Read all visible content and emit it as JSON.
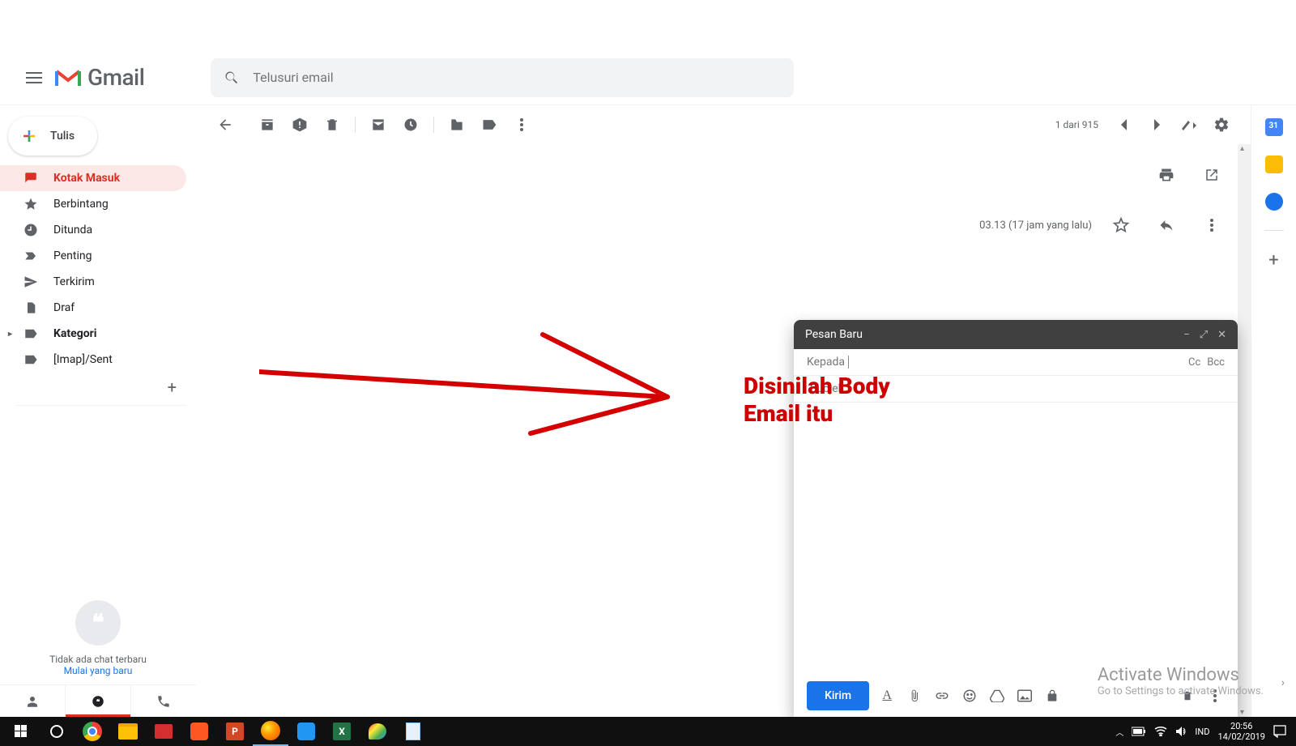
{
  "header": {
    "app_name": "Gmail",
    "search_placeholder": "Telusuri email"
  },
  "compose_button": "Tulis",
  "sidebar": {
    "items": [
      {
        "label": "Kotak Masuk"
      },
      {
        "label": "Berbintang"
      },
      {
        "label": "Ditunda"
      },
      {
        "label": "Penting"
      },
      {
        "label": "Terkirim"
      },
      {
        "label": "Draf"
      },
      {
        "label": "Kategori"
      },
      {
        "label": "[Imap]/Sent"
      }
    ]
  },
  "hangouts": {
    "no_chat": "Tidak ada chat terbaru",
    "start_new": "Mulai yang baru"
  },
  "toolbar": {
    "pager": "1 dari 915"
  },
  "message": {
    "time": "03.13 (17 jam yang lalu)"
  },
  "compose": {
    "title": "Pesan Baru",
    "to_label": "Kepada",
    "cc": "Cc",
    "bcc": "Bcc",
    "subject_placeholder": "Subjek",
    "send": "Kirim"
  },
  "annotation": {
    "line1": "Disinilah Body",
    "line2": "Email itu"
  },
  "watermark": {
    "title": "Activate Windows",
    "sub": "Go to Settings to activate Windows."
  },
  "taskbar": {
    "lang": "IND",
    "time": "20:56",
    "date": "14/02/2019"
  }
}
